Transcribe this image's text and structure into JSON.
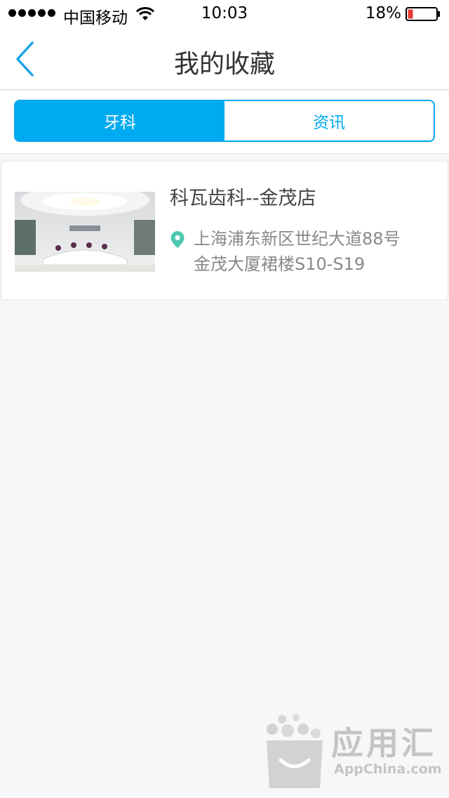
{
  "status_bar": {
    "carrier": "中国移动",
    "time": "10:03",
    "battery_percent": "18%",
    "battery_level": 0.18
  },
  "nav": {
    "back_icon": "chevron-left-icon",
    "title": "我的收藏"
  },
  "tabs": [
    {
      "label": "牙科",
      "active": true
    },
    {
      "label": "资讯",
      "active": false
    }
  ],
  "favorites": [
    {
      "name": "科瓦齿科--金茂店",
      "address_line1": "上海浦东新区世纪大道88号",
      "address_line2": "金茂大厦裙楼S10-S19",
      "location_icon": "map-pin-icon"
    }
  ],
  "watermark": {
    "name": "应用汇",
    "url": "AppChina.com"
  },
  "colors": {
    "accent": "#00aaf0",
    "pin": "#4ec9b0",
    "battery_low": "#e53935"
  }
}
